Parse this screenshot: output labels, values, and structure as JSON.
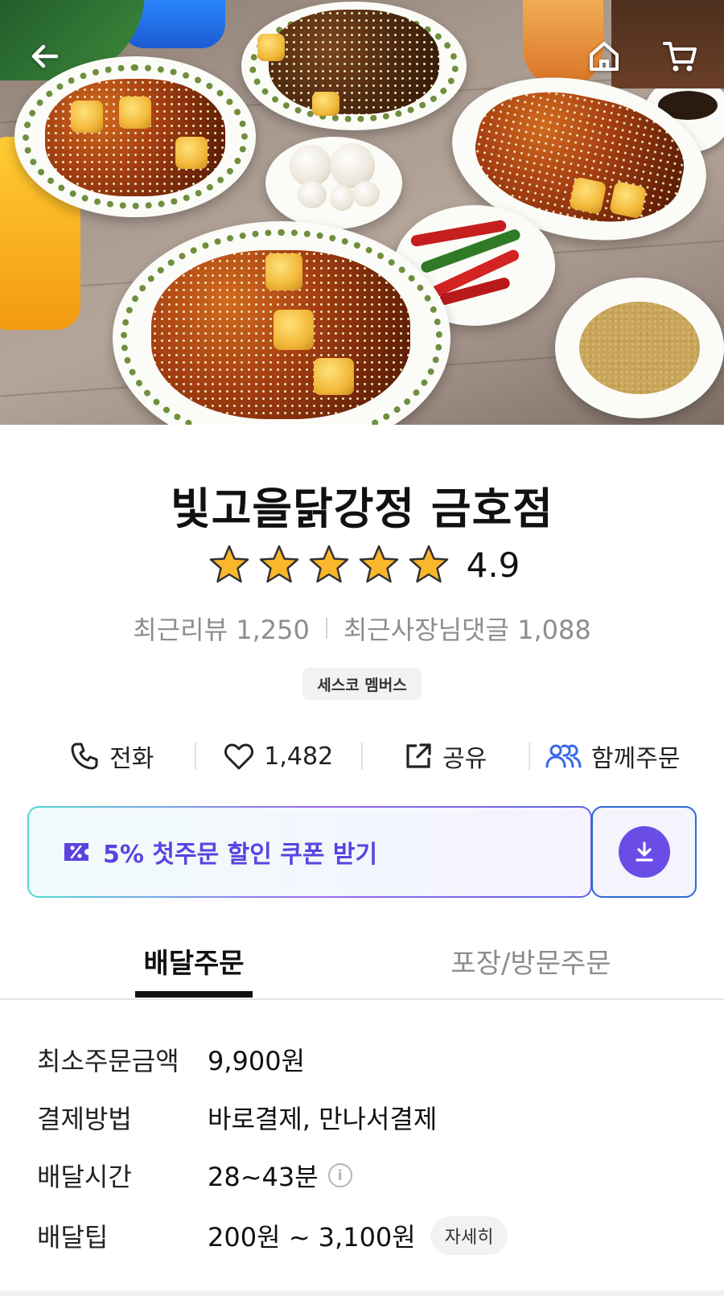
{
  "hero": {
    "image_alt": "",
    "back_icon": "back-arrow-icon",
    "home_icon": "home-icon",
    "cart_icon": "cart-icon"
  },
  "store": {
    "name": "빛고을닭강정 금호점",
    "rating": "4.9",
    "rating_stars": 5,
    "recent_reviews_label": "최근리뷰 1,250",
    "recent_owner_replies_label": "최근사장님댓글 1,088",
    "badge": "세스코 멤버스"
  },
  "actions": {
    "call": "전화",
    "likes": "1,482",
    "share": "공유",
    "group_order": "함께주문"
  },
  "coupon": {
    "label": "5% 첫주문 할인 쿠폰 받기",
    "accent": "#5a43e0"
  },
  "tabs": {
    "delivery": "배달주문",
    "pickup": "포장/방문주문",
    "active": "delivery"
  },
  "details": {
    "min_order_label": "최소주문금액",
    "min_order_value": "9,900원",
    "payment_label": "결제방법",
    "payment_value": "바로결제, 만나서결제",
    "delivery_time_label": "배달시간",
    "delivery_time_value": "28~43분",
    "delivery_tip_label": "배달팁",
    "delivery_tip_value": "200원 ~ 3,100원",
    "delivery_tip_button": "자세히"
  }
}
